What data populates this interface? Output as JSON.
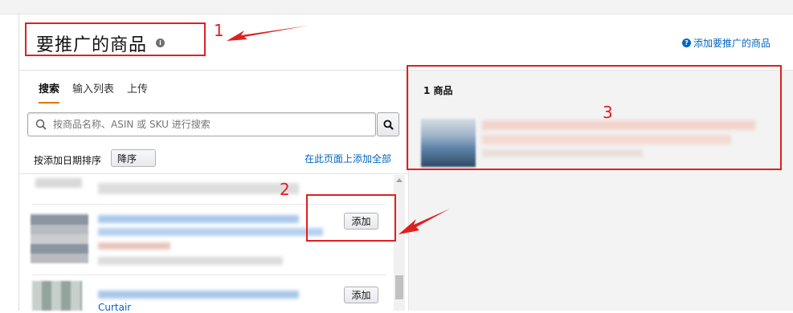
{
  "header": {
    "title": "要推广的商品",
    "help_link": "添加要推广的商品"
  },
  "left_pane": {
    "tabs": [
      {
        "label": "搜索",
        "active": true
      },
      {
        "label": "输入列表",
        "active": false
      },
      {
        "label": "上传",
        "active": false
      }
    ],
    "search": {
      "placeholder": "按商品名称、ASIN 或 SKU 进行搜索",
      "value": ""
    },
    "sort": {
      "label": "按添加日期排序",
      "selected": "降序"
    },
    "add_all_link": "在此页面上添加全部",
    "items": [
      {
        "add_label": "添加"
      },
      {
        "add_label": "添加",
        "visible_text": "Curtair"
      }
    ]
  },
  "right_pane": {
    "count_label": "1 商品"
  },
  "annotations": {
    "numbers": [
      "1",
      "2",
      "3"
    ],
    "color": "#e02020"
  },
  "colors": {
    "link": "#0066c0",
    "active_tab_underline": "#e77600",
    "right_pane_bg": "#f3f3f3"
  }
}
